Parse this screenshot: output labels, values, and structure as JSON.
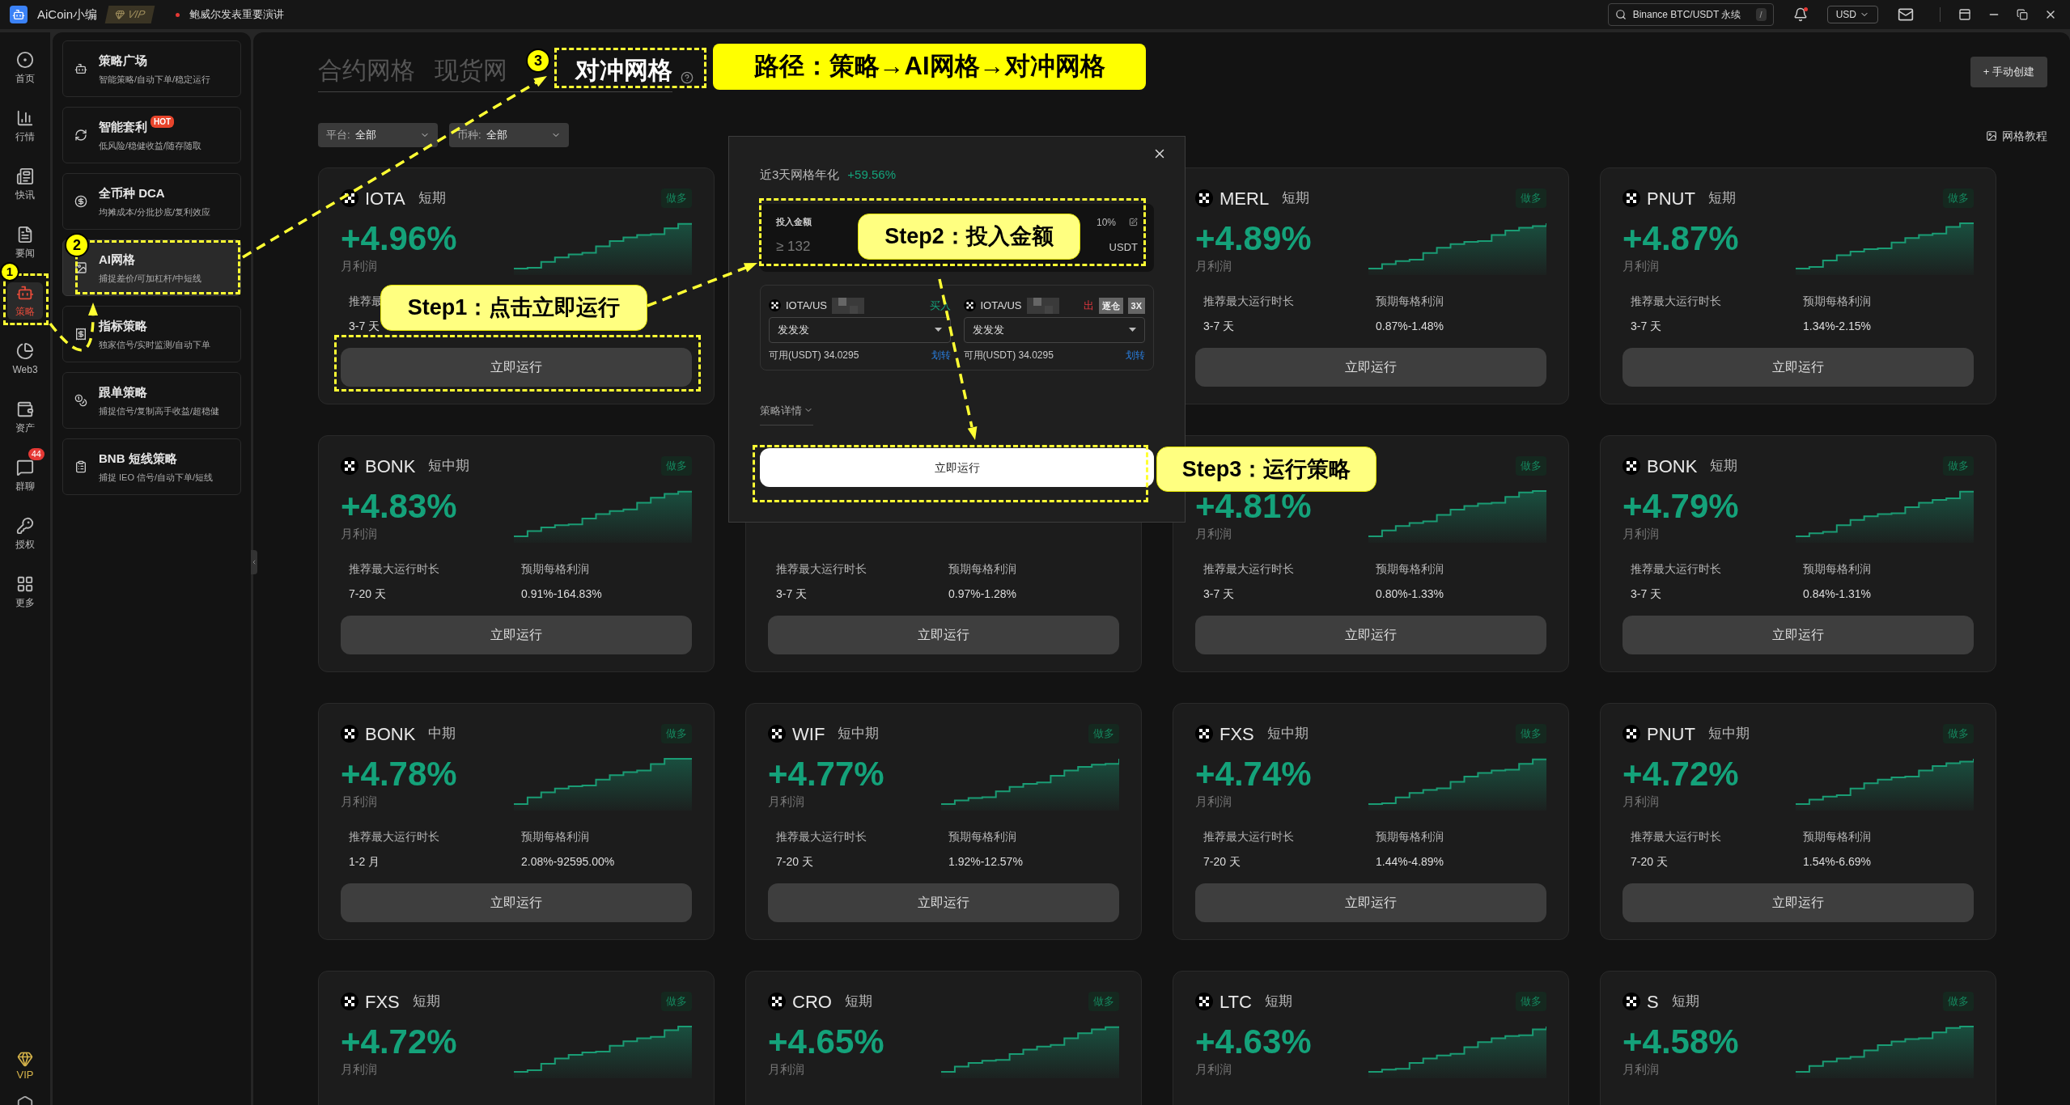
{
  "top_bar": {
    "app_name": "AiCoin小编",
    "vip": "VIP",
    "news": "鲍威尔发表重要演讲",
    "search": {
      "value": "Binance BTC/USDT 永续",
      "shortcut": "/"
    },
    "currency": "USD"
  },
  "rail": [
    {
      "label": "首页",
      "selected": false
    },
    {
      "label": "行情",
      "selected": false
    },
    {
      "label": "快讯",
      "selected": false
    },
    {
      "label": "要闻",
      "selected": false
    },
    {
      "label": "策略",
      "selected": true
    },
    {
      "label": "Web3",
      "selected": false
    },
    {
      "label": "资产",
      "selected": false
    },
    {
      "label": "群聊",
      "selected": false,
      "badge": "44"
    },
    {
      "label": "授权",
      "selected": false
    },
    {
      "label": "更多",
      "selected": false
    }
  ],
  "rail_bottom": {
    "label": "VIP"
  },
  "sidebar": [
    {
      "title": "策略广场",
      "subtitle": "智能策略/自动下单/稳定运行",
      "selected": false
    },
    {
      "title": "智能套利",
      "subtitle": "低风险/稳健收益/随存随取",
      "selected": false,
      "badge": "HOT"
    },
    {
      "title": "全币种 DCA",
      "subtitle": "均摊成本/分批抄底/复利效应",
      "selected": false
    },
    {
      "title": "AI网格",
      "subtitle": "捕捉差价/可加杠杆/中短线",
      "selected": true
    },
    {
      "title": "指标策略",
      "subtitle": "独家信号/实时监测/自动下单",
      "selected": false
    },
    {
      "title": "跟单策略",
      "subtitle": "捕捉信号/复制高手收益/超稳健",
      "selected": false
    },
    {
      "title": "BNB 短线策略",
      "subtitle": "捕捉 IEO 信号/自动下单/短线",
      "selected": false
    }
  ],
  "tabs": [
    {
      "label": "合约网格",
      "selected": false
    },
    {
      "label": "现货网",
      "selected": false
    },
    {
      "label": "对冲网格",
      "selected": true
    }
  ],
  "create_button": "+ 手动创建",
  "filters": [
    {
      "label": "平台:",
      "value": "全部"
    },
    {
      "label": "币种:",
      "value": "全部"
    }
  ],
  "tutorial_link": "网格教程",
  "cards": [
    {
      "coin": "IOTA",
      "term": "短期",
      "badge": "做多",
      "profit": "+4.96%",
      "profit_label": "月利润",
      "stats": [
        {
          "label": "推荐最",
          "value": "3-7 天"
        }
      ],
      "button": "立即运行"
    },
    {
      "coin": "MERL",
      "term": "短期",
      "badge": "做多",
      "profit": "+4.89%",
      "profit_label": "月利润",
      "stats": [
        {
          "label": "推荐最大运行时长",
          "value": "3-7 天"
        },
        {
          "label": "预期每格利润",
          "value": "0.87%-1.48%"
        }
      ],
      "button": "立即运行"
    },
    {
      "coin": "PNUT",
      "term": "短期",
      "badge": "做多",
      "profit": "+4.87%",
      "profit_label": "月利润",
      "stats": [
        {
          "label": "推荐最大运行时长",
          "value": "3-7 天"
        },
        {
          "label": "预期每格利润",
          "value": "1.34%-2.15%"
        }
      ],
      "button": "立即运行"
    },
    {
      "coin": "BONK",
      "term": "短中期",
      "badge": "做多",
      "profit": "+4.83%",
      "profit_label": "月利润",
      "stats": [
        {
          "label": "推荐最大运行时长",
          "value": "7-20 天"
        },
        {
          "label": "预期每格利润",
          "value": "0.91%-164.83%"
        }
      ],
      "button": "立即运行"
    },
    {
      "stats": [
        {
          "label": "推荐最大运行时长",
          "value": "3-7 天"
        },
        {
          "label": "预期每格利润",
          "value": "0.97%-1.28%"
        }
      ],
      "button": "立即运行"
    },
    {
      "badge": "做多",
      "profit": "+4.81%",
      "profit_label": "月利润",
      "stats": [
        {
          "label": "推荐最大运行时长",
          "value": "3-7 天"
        },
        {
          "label": "预期每格利润",
          "value": "0.80%-1.33%"
        }
      ],
      "button": "立即运行"
    },
    {
      "coin": "BONK",
      "term": "短期",
      "badge": "做多",
      "profit": "+4.79%",
      "profit_label": "月利润",
      "stats": [
        {
          "label": "推荐最大运行时长",
          "value": "3-7 天"
        },
        {
          "label": "预期每格利润",
          "value": "0.84%-1.31%"
        }
      ],
      "button": "立即运行"
    },
    {
      "coin": "BONK",
      "term": "中期",
      "badge": "做多",
      "profit": "+4.78%",
      "profit_label": "月利润",
      "stats": [
        {
          "label": "推荐最大运行时长",
          "value": "1-2 月"
        },
        {
          "label": "预期每格利润",
          "value": "2.08%-92595.00%"
        }
      ],
      "button": "立即运行"
    },
    {
      "coin": "WIF",
      "term": "短中期",
      "badge": "做多",
      "profit": "+4.77%",
      "profit_label": "月利润",
      "stats": [
        {
          "label": "推荐最大运行时长",
          "value": "7-20 天"
        },
        {
          "label": "预期每格利润",
          "value": "1.92%-12.57%"
        }
      ],
      "button": "立即运行"
    },
    {
      "coin": "FXS",
      "term": "短中期",
      "badge": "做多",
      "profit": "+4.74%",
      "profit_label": "月利润",
      "stats": [
        {
          "label": "推荐最大运行时长",
          "value": "7-20 天"
        },
        {
          "label": "预期每格利润",
          "value": "1.44%-4.89%"
        }
      ],
      "button": "立即运行"
    },
    {
      "coin": "PNUT",
      "term": "短中期",
      "badge": "做多",
      "profit": "+4.72%",
      "profit_label": "月利润",
      "stats": [
        {
          "label": "推荐最大运行时长",
          "value": "7-20 天"
        },
        {
          "label": "预期每格利润",
          "value": "1.54%-6.69%"
        }
      ],
      "button": "立即运行"
    },
    {
      "coin": "FXS",
      "term": "短期",
      "badge": "做多",
      "profit": "+4.72%",
      "profit_label": "月利润"
    },
    {
      "coin": "CRO",
      "term": "短期",
      "badge": "做多",
      "profit": "+4.65%",
      "profit_label": "月利润"
    },
    {
      "coin": "LTC",
      "term": "短期",
      "badge": "做多",
      "profit": "+4.63%",
      "profit_label": "月利润"
    },
    {
      "coin": "S",
      "term": "短期",
      "badge": "做多",
      "profit": "+4.58%",
      "profit_label": "月利润"
    }
  ],
  "modal": {
    "title": "近3天网格年化",
    "annual": "+59.56%",
    "amount": {
      "label": "投入金额",
      "placeholder": "≥ 132",
      "percent": "10%",
      "unit": "USDT"
    },
    "legs": [
      {
        "kind": "buy",
        "pair": "IOTA/US",
        "side": "买入",
        "select": "发发发",
        "available": "可用(USDT) 34.0295",
        "transfer": "划转"
      },
      {
        "kind": "sell",
        "pair": "IOTA/US",
        "side": "出",
        "tags": [
          "逐仓",
          "3X"
        ],
        "select": "发发发",
        "available": "可用(USDT) 34.0295",
        "transfer": "划转"
      }
    ],
    "details": "策略详情",
    "run_button": "立即运行"
  },
  "annotations": {
    "markers": [
      "1",
      "2",
      "3"
    ],
    "path_label": "路径：策略→AI网格→对冲网格",
    "steps": [
      "Step1：点击立即运行",
      "Step2：投入金额",
      "Step3：运行策略"
    ]
  }
}
